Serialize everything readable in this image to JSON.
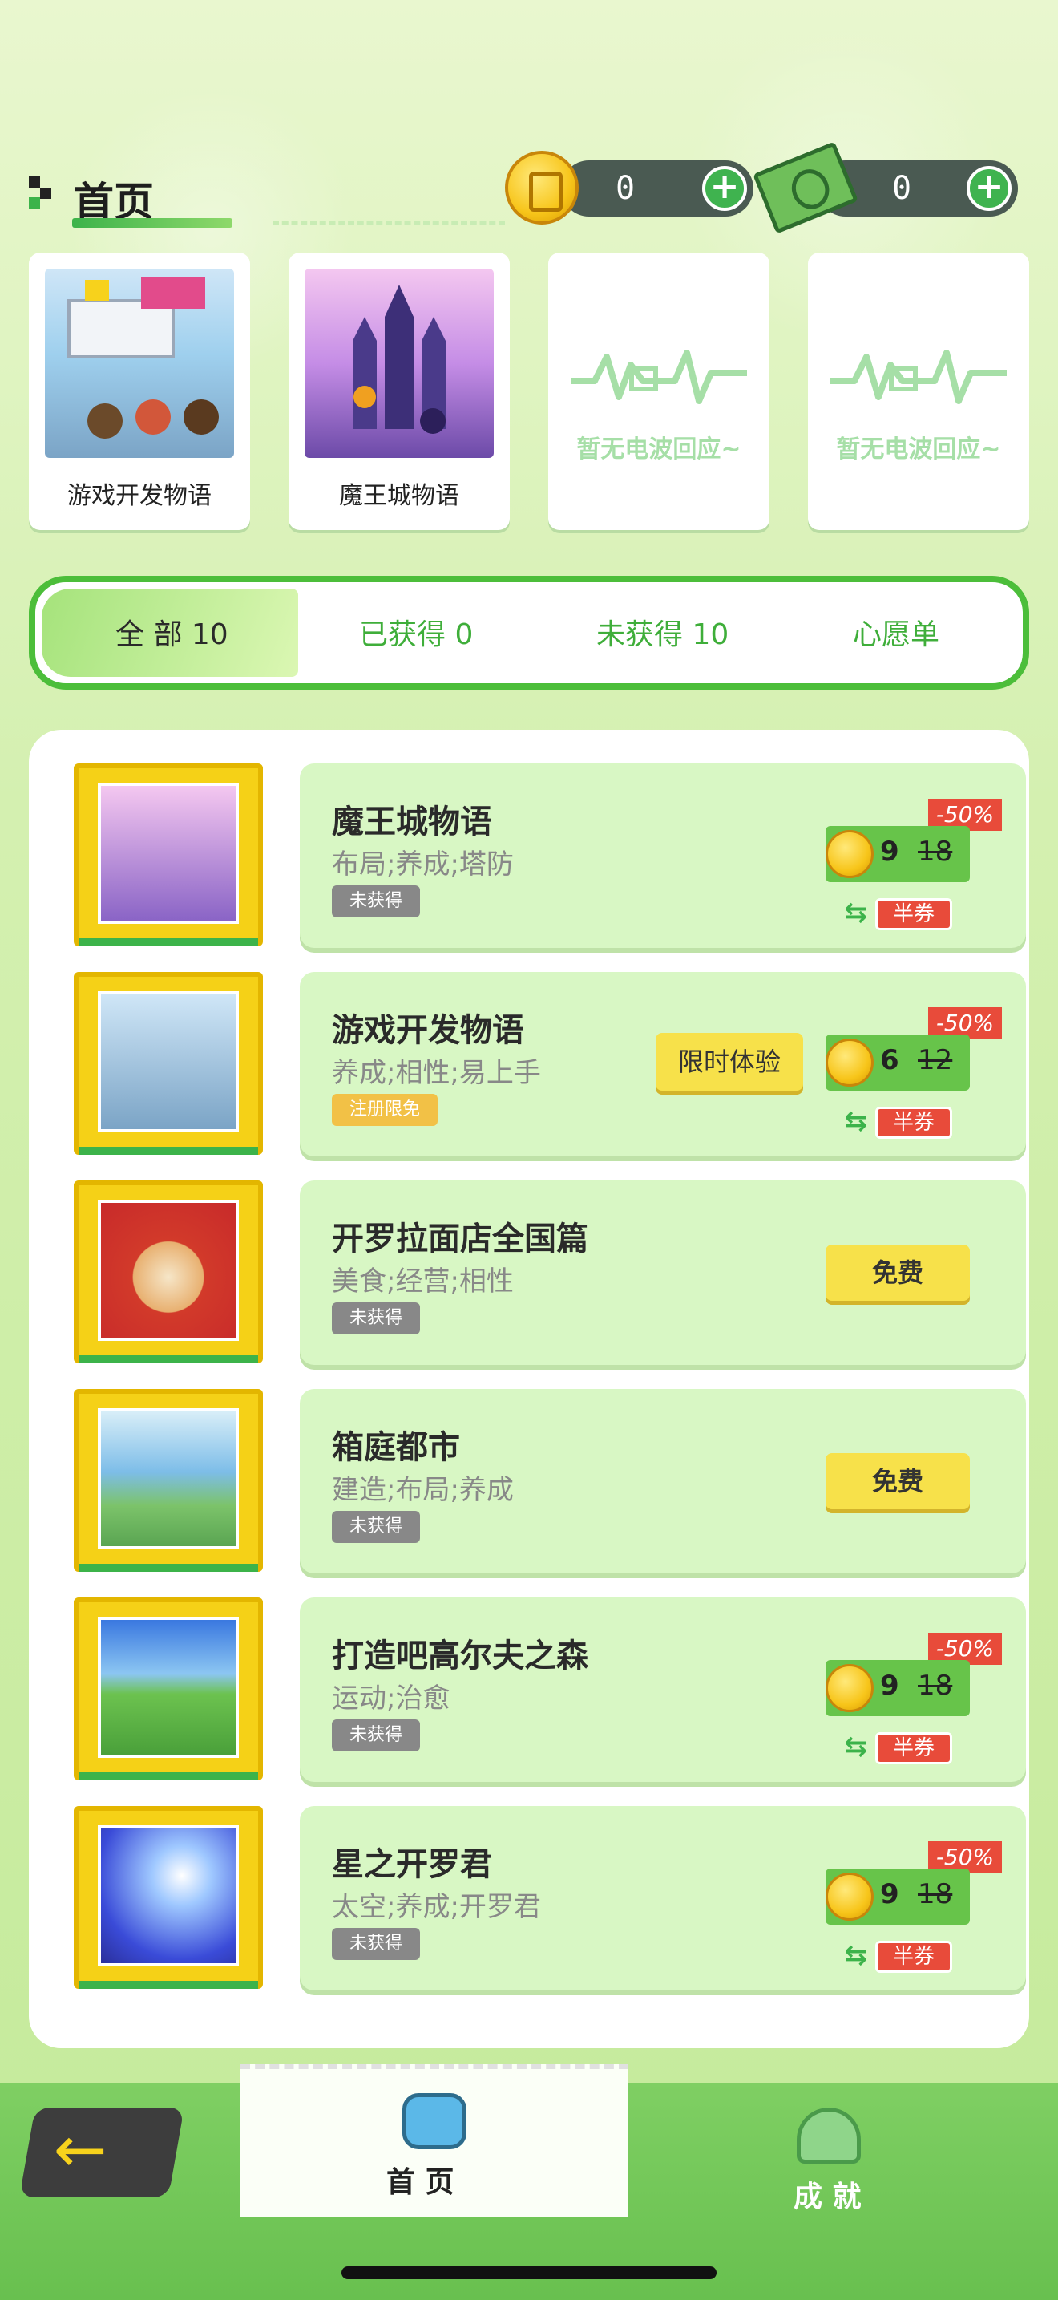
{
  "header": {
    "title": "首页",
    "coins": "0",
    "cash": "0",
    "plus_label": "+"
  },
  "featured": [
    {
      "label": "游戏开发物语"
    },
    {
      "label": "魔王城物语"
    },
    {
      "empty_text": "暂无电波回应~"
    },
    {
      "empty_text": "暂无电波回应~"
    }
  ],
  "tabs": [
    {
      "label": "全 部 10"
    },
    {
      "label": "已获得 0"
    },
    {
      "label": "未获得 10"
    },
    {
      "label": "心愿单"
    }
  ],
  "games": [
    {
      "name": "魔王城物语",
      "tags": "布局;养成;塔防",
      "status": "未获得",
      "discount": "-50%",
      "price": "9",
      "original": "18",
      "half": "半券"
    },
    {
      "name": "游戏开发物语",
      "tags": "养成;相性;易上手",
      "status": "注册限免",
      "trial": "限时体验",
      "discount": "-50%",
      "price": "6",
      "original": "12",
      "half": "半券"
    },
    {
      "name": "开罗拉面店全国篇",
      "tags": "美食;经营;相性",
      "status": "未获得",
      "free": "免费"
    },
    {
      "name": "箱庭都市",
      "tags": "建造;布局;养成",
      "status": "未获得",
      "free": "免费"
    },
    {
      "name": "打造吧高尔夫之森",
      "tags": "运动;治愈",
      "status": "未获得",
      "discount": "-50%",
      "price": "9",
      "original": "18",
      "half": "半券"
    },
    {
      "name": "星之开罗君",
      "tags": "太空;养成;开罗君",
      "status": "未获得",
      "discount": "-50%",
      "price": "9",
      "original": "18",
      "half": "半券"
    }
  ],
  "nav": {
    "back": "←",
    "home": "首 页",
    "achievements": "成 就"
  },
  "colors": {
    "accent_green": "#3cb34a",
    "discount_red": "#e84b3a",
    "free_yellow": "#f7e14a"
  }
}
